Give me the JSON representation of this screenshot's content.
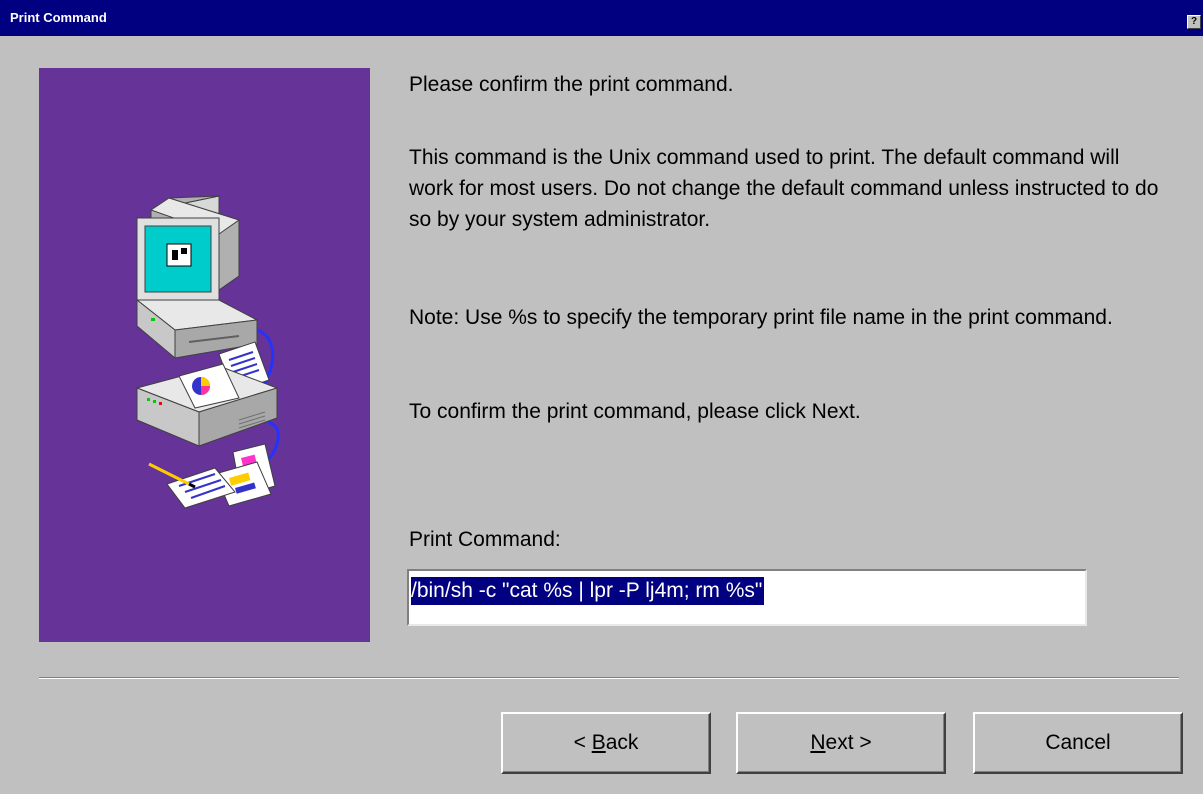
{
  "window": {
    "title": "Print Command",
    "help_label": "?"
  },
  "content": {
    "line1": "Please confirm the print command.",
    "para1": "This command is the Unix command used to print. The default command will work for most users. Do not change the default command unless instructed to do so by your system administrator.",
    "para2": "Note: Use %s to specify the temporary print file name in the print command.",
    "line2": "To confirm the print command, please click Next.",
    "field_label": "Print Command:",
    "field_value": "/bin/sh -c \"cat %s | lpr -P lj4m; rm %s\""
  },
  "buttons": {
    "back": {
      "prefix": "< ",
      "mnemonic": "B",
      "rest": "ack"
    },
    "next": {
      "prefix": "",
      "mnemonic": "N",
      "rest": "ext >"
    },
    "cancel": "Cancel"
  },
  "colors": {
    "titlebar": "#000080",
    "panel": "#663399",
    "face": "#c0c0c0",
    "selection": "#000080"
  },
  "icons": [
    "computer-icon",
    "printer-icon",
    "printed-pages-icon"
  ]
}
